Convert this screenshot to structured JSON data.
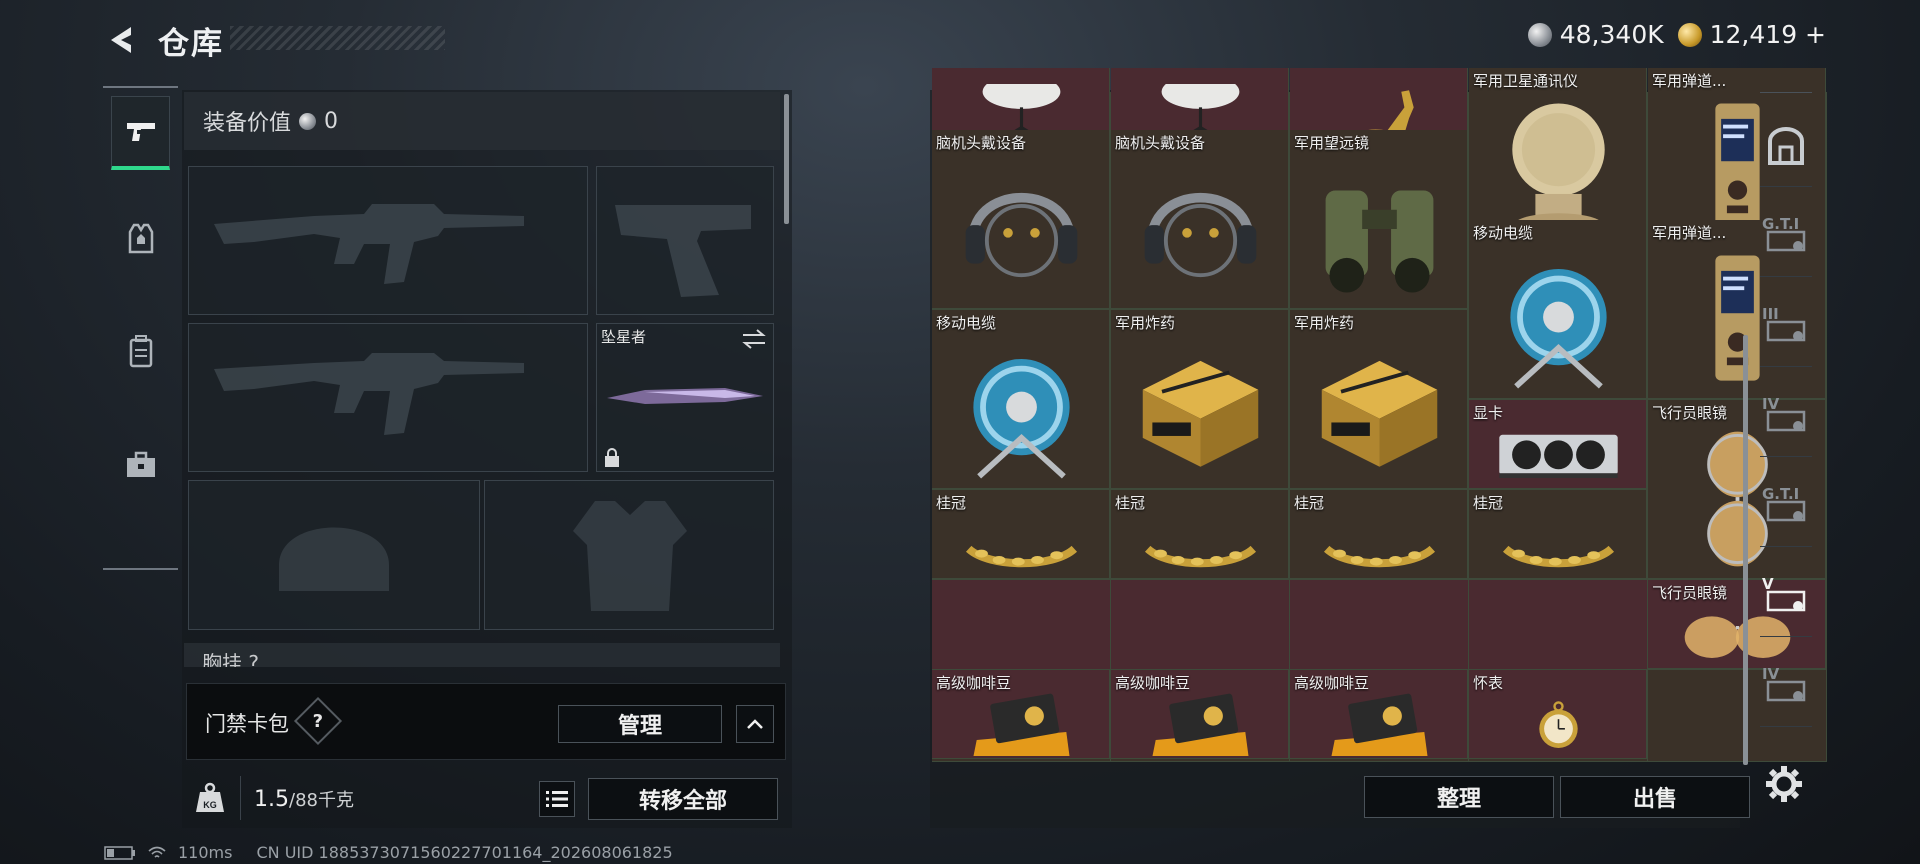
{
  "header": {
    "title": "仓库"
  },
  "currency": [
    {
      "icon": "silver-coin-icon",
      "value": "48,340K"
    },
    {
      "icon": "gold-coin-icon",
      "value": "12,419 +"
    }
  ],
  "left_tabs": [
    {
      "icon": "pistol-icon",
      "active": true
    },
    {
      "icon": "vest-icon",
      "active": false
    },
    {
      "icon": "backpack-icon",
      "active": false
    },
    {
      "icon": "briefcase-icon",
      "active": false
    }
  ],
  "equipment": {
    "value_label": "装备价值",
    "value": "0",
    "melee_name": "坠星者",
    "partial_label": "胸挂 ?"
  },
  "card_bag": {
    "label": "门禁卡包",
    "help": "?",
    "manage_button": "管理",
    "expand_icon": "chevron-up-icon"
  },
  "weight": {
    "current": "1.5",
    "max": "/88千克",
    "transfer_all_button": "转移全部"
  },
  "status": {
    "latency": "110ms",
    "uid": "CN UID 1885373071560227701164_202608061825"
  },
  "storage": {
    "items": [
      {
        "name": "",
        "kind": "dish"
      },
      {
        "name": "",
        "kind": "dish"
      },
      {
        "name": "",
        "kind": "deer"
      },
      {
        "name": "军用卫星通讯仪",
        "kind": "satellite"
      },
      {
        "name": "军用弹道...",
        "kind": "computer"
      },
      {
        "name": "脑机头戴设备",
        "kind": "headset"
      },
      {
        "name": "脑机头戴设备",
        "kind": "headset"
      },
      {
        "name": "军用望远镜",
        "kind": "binoculars"
      },
      {
        "name": "移动电缆",
        "kind": "reel"
      },
      {
        "name": "军用弹道...",
        "kind": "computer"
      },
      {
        "name": "移动电缆",
        "kind": "reel"
      },
      {
        "name": "军用炸药",
        "kind": "crate"
      },
      {
        "name": "军用炸药",
        "kind": "crate"
      },
      {
        "name": "显卡",
        "kind": "gpu"
      },
      {
        "name": "飞行员眼镜",
        "kind": "glasses"
      },
      {
        "name": "桂冠",
        "kind": "laurel"
      },
      {
        "name": "桂冠",
        "kind": "laurel"
      },
      {
        "name": "桂冠",
        "kind": "laurel"
      },
      {
        "name": "桂冠",
        "kind": "laurel"
      },
      {
        "name": "飞行员眼镜",
        "kind": "glasses"
      },
      {
        "name": "高级咖啡豆",
        "kind": "coffee"
      },
      {
        "name": "高级咖啡豆",
        "kind": "coffee"
      },
      {
        "name": "高级咖啡豆",
        "kind": "coffee"
      },
      {
        "name": "怀表",
        "kind": "watch"
      }
    ],
    "sort_button": "整理",
    "sell_button": "出售"
  },
  "right_tabs": [
    "",
    "G.T.I",
    "III",
    "IV",
    "G.T.I",
    "V",
    "IV"
  ]
}
